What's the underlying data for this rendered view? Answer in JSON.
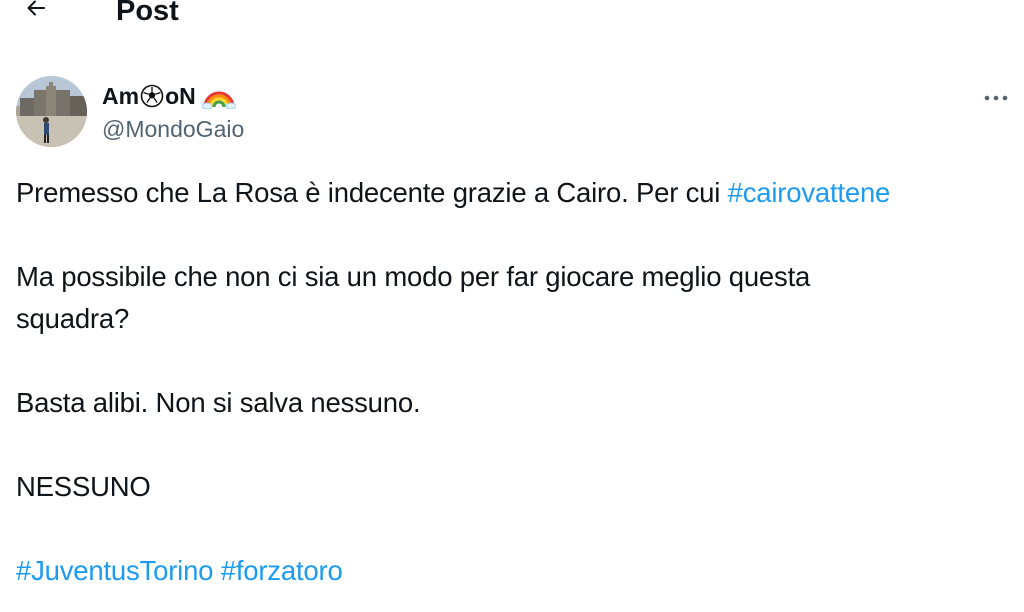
{
  "header": {
    "title": "Post",
    "back_icon": "arrow-left-icon"
  },
  "author": {
    "display_name_before": "Am",
    "display_name_after": "oN",
    "display_name_icons": [
      "soccer-ball-icon",
      "rainbow-icon"
    ],
    "handle": "@MondoGaio",
    "avatar": "avatar-photo"
  },
  "more_icon": "more-horizontal-icon",
  "tweet": {
    "line1_text": "Premesso che La Rosa è indecente grazie a Cairo. Per cui ",
    "line1_tag": "#cairovattene",
    "line2": "Ma possibile che non ci sia un modo per far giocare meglio questa",
    "line3": "squadra?",
    "line4": "Basta alibi. Non si salva nessuno.",
    "line5": "NESSUNO",
    "tag_juve": "#JuventusTorino",
    "tag_toro": "#forzatoro"
  },
  "colors": {
    "text": "#0f1419",
    "secondary": "#536471",
    "link": "#1d9bf0"
  }
}
